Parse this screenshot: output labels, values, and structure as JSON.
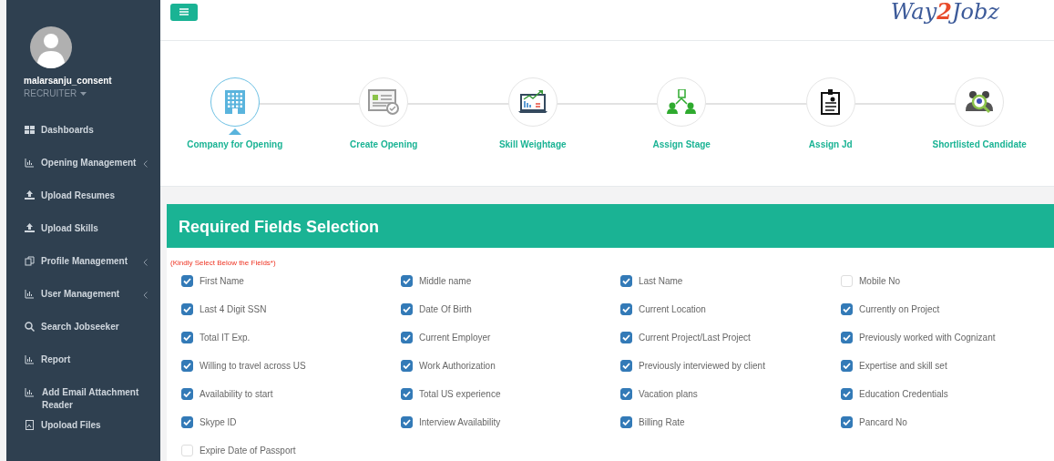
{
  "sidebar": {
    "user": {
      "name": "malarsanju_consent",
      "role": "RECRUITER"
    },
    "items": [
      {
        "label": "Dashboards",
        "expandable": false
      },
      {
        "label": "Opening Management",
        "expandable": true
      },
      {
        "label": "Upload Resumes",
        "expandable": false
      },
      {
        "label": "Upload Skills",
        "expandable": false
      },
      {
        "label": "Profile Management",
        "expandable": true
      },
      {
        "label": "User Management",
        "expandable": true
      },
      {
        "label": "Search Jobseeker",
        "expandable": false
      },
      {
        "label": "Report",
        "expandable": false
      },
      {
        "label": "Add Email Attachment Reader",
        "expandable": false
      },
      {
        "label": "Upoload Files",
        "expandable": false
      }
    ]
  },
  "header": {
    "logo": [
      "Way",
      "2",
      "Jobz"
    ]
  },
  "steps": [
    {
      "label": "Company for Opening",
      "selected": true
    },
    {
      "label": "Create Opening",
      "selected": false
    },
    {
      "label": "Skill Weightage",
      "selected": false
    },
    {
      "label": "Assign Stage",
      "selected": false
    },
    {
      "label": "Assign Jd",
      "selected": false
    },
    {
      "label": "Shortlisted Candidate",
      "selected": false
    }
  ],
  "panel": {
    "title": "Required Fields Selection",
    "hint": "(Kindly Select Below the Fields*)",
    "fields": [
      {
        "label": "First Name",
        "checked": true
      },
      {
        "label": "Middle name",
        "checked": true
      },
      {
        "label": "Last Name",
        "checked": true
      },
      {
        "label": "Mobile No",
        "checked": false
      },
      {
        "label": "Last 4 Digit SSN",
        "checked": true
      },
      {
        "label": "Date Of Birth",
        "checked": true
      },
      {
        "label": "Current Location",
        "checked": true
      },
      {
        "label": "Currently on Project",
        "checked": true
      },
      {
        "label": "Total IT Exp.",
        "checked": true
      },
      {
        "label": "Current Employer",
        "checked": true
      },
      {
        "label": "Current Project/Last Project",
        "checked": true
      },
      {
        "label": "Previously worked with Cognizant",
        "checked": true
      },
      {
        "label": "Willing to travel across US",
        "checked": true
      },
      {
        "label": "Work Authorization",
        "checked": true
      },
      {
        "label": "Previously interviewed by client",
        "checked": true
      },
      {
        "label": "Expertise and skill set",
        "checked": true
      },
      {
        "label": "Availability to start",
        "checked": true
      },
      {
        "label": "Total US experience",
        "checked": true
      },
      {
        "label": "Vacation plans",
        "checked": true
      },
      {
        "label": "Education Credentials",
        "checked": true
      },
      {
        "label": "Skype ID",
        "checked": true
      },
      {
        "label": "Interview Availability",
        "checked": true
      },
      {
        "label": "Billing Rate",
        "checked": true
      },
      {
        "label": "Pancard No",
        "checked": true
      },
      {
        "label": "Expire Date of Passport",
        "checked": false
      }
    ]
  }
}
